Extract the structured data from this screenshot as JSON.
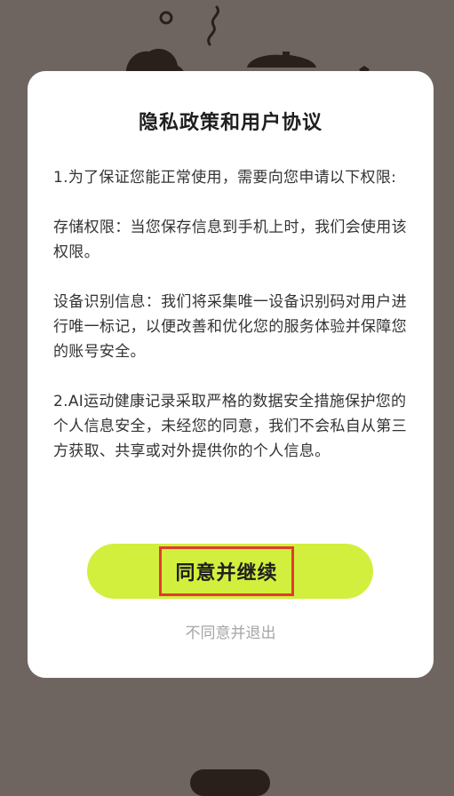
{
  "dialog": {
    "title": "隐私政策和用户协议",
    "paragraphs": [
      "1.为了保证您能正常使用，需要向您申请以下权限:",
      "存储权限：当您保存信息到手机上时，我们会使用该权限。",
      "设备识别信息：我们将采集唯一设备识别码对用户进行唯一标记，以便改善和优化您的服务体验并保障您的账号安全。",
      "2.AI运动健康记录采取严格的数据安全措施保护您的个人信息安全，未经您的同意，我们不会私自从第三方获取、共享或对外提供你的个人信息。"
    ],
    "agree_label": "同意并继续",
    "disagree_label": "不同意并退出"
  },
  "colors": {
    "overlay": "#6e6561",
    "dialog": "#ffffff",
    "accent": "#d2ef3e",
    "highlight_box": "#e23a2f",
    "secondary_text": "#a6a6a6"
  }
}
